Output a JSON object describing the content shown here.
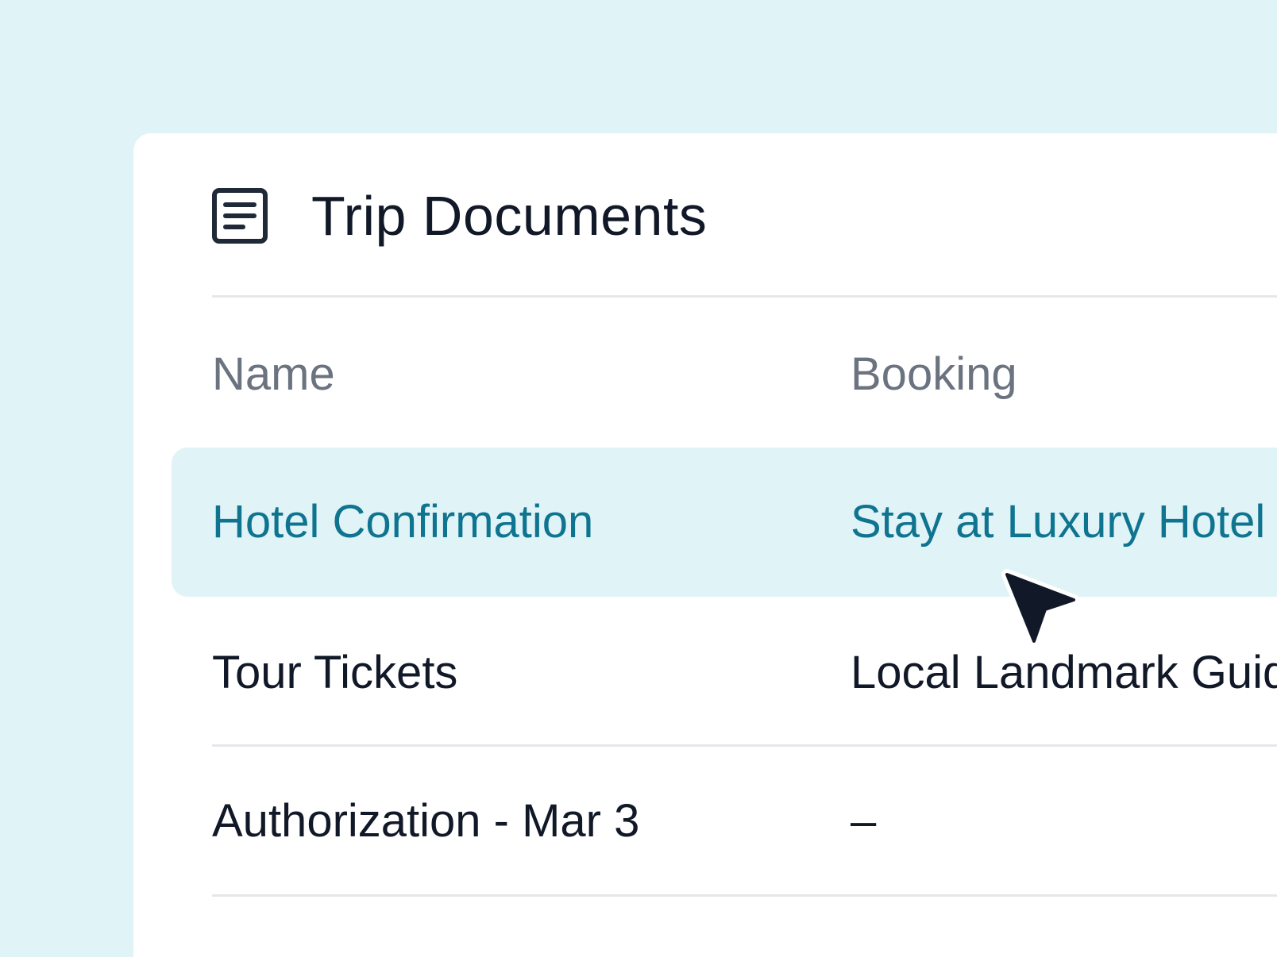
{
  "panel": {
    "title": "Trip Documents",
    "icon": "document-icon"
  },
  "table": {
    "columns": [
      "Name",
      "Booking"
    ],
    "rows": [
      {
        "name": "Hotel Confirmation",
        "booking": "Stay at Luxury Hotel",
        "highlighted": true
      },
      {
        "name": "Tour Tickets",
        "booking": "Local Landmark Guided Tour",
        "highlighted": false
      },
      {
        "name": "Authorization - Mar 3",
        "booking": "–",
        "highlighted": false
      }
    ]
  },
  "cursor": {
    "icon": "pointer-cursor-icon"
  },
  "colors": {
    "background": "#e0f3f7",
    "card": "#ffffff",
    "accent": "#0e7490",
    "header_text": "#6b7280",
    "body_text": "#111827",
    "highlight_row": "#e0f3f7",
    "divider": "#e5e7eb"
  }
}
